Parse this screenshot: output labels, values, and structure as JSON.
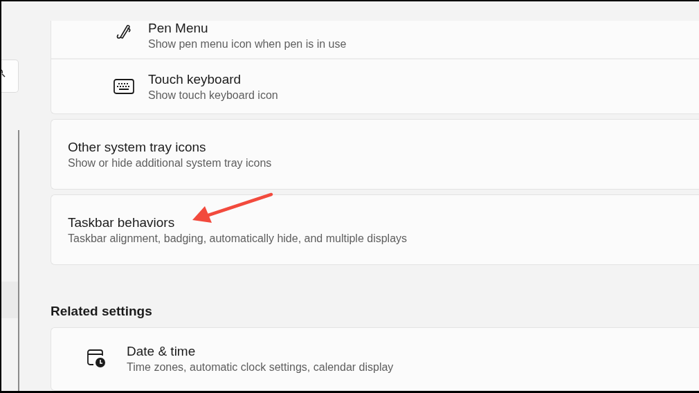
{
  "cards": [
    {
      "rows": [
        {
          "kind": "pen",
          "title": "Pen Menu",
          "description": "Show pen menu icon when pen is in use"
        },
        {
          "kind": "keyboard",
          "title": "Touch keyboard",
          "description": "Show touch keyboard icon"
        }
      ]
    },
    {
      "rows": [
        {
          "kind": "plain",
          "title": "Other system tray icons",
          "description": "Show or hide additional system tray icons"
        }
      ]
    },
    {
      "rows": [
        {
          "kind": "plain",
          "title": "Taskbar behaviors",
          "description": "Taskbar alignment, badging, automatically hide, and multiple displays"
        }
      ]
    }
  ],
  "related_settings": {
    "heading": "Related settings",
    "rows": [
      {
        "kind": "datetime",
        "title": "Date & time",
        "description": "Time zones, automatic clock settings, calendar display"
      }
    ]
  }
}
